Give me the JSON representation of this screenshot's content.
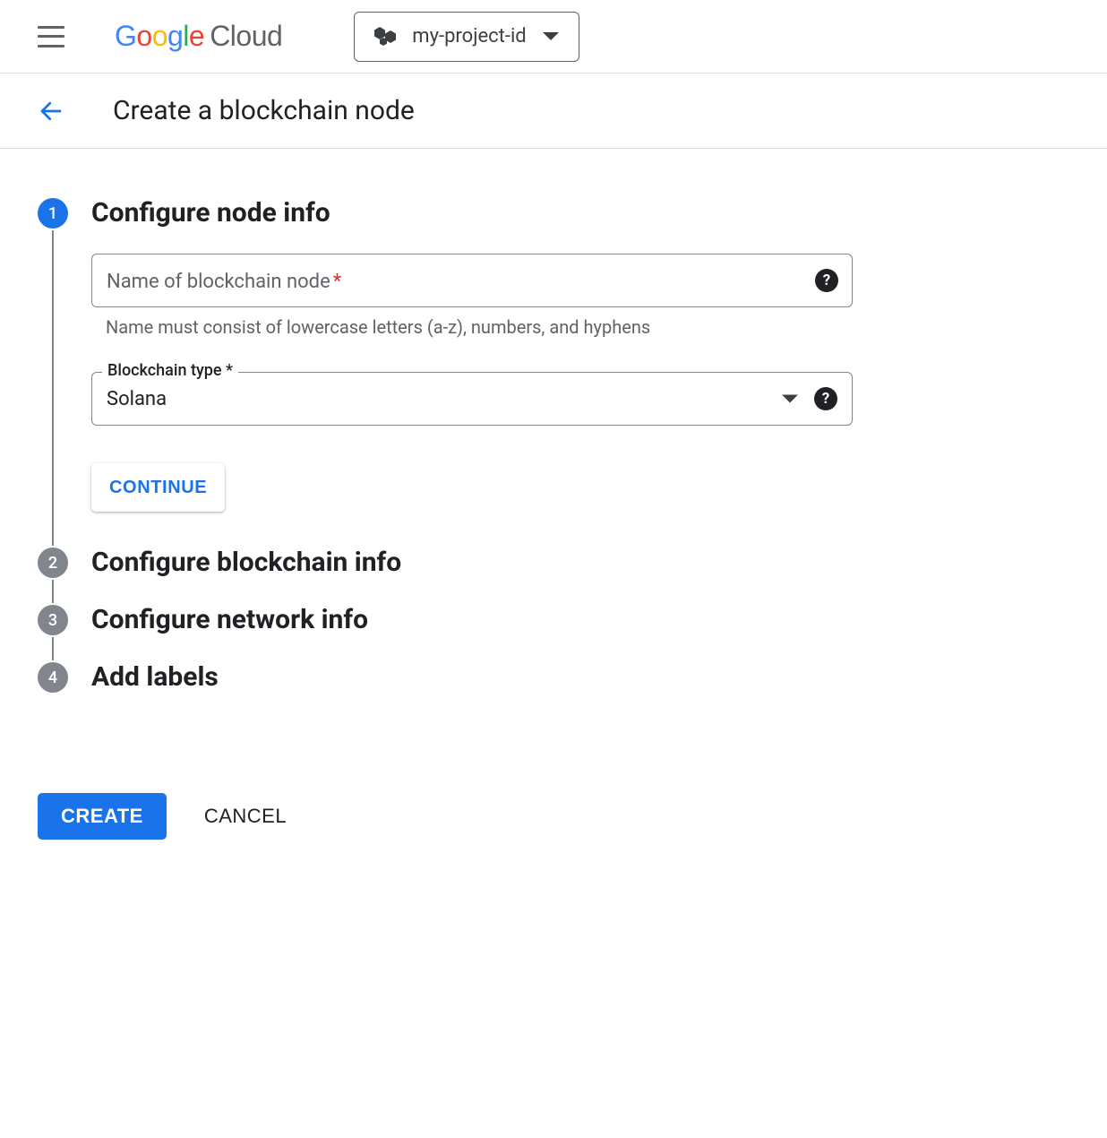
{
  "header": {
    "logo_google": "Google",
    "logo_cloud": "Cloud",
    "project_id": "my-project-id"
  },
  "page": {
    "title": "Create a blockchain node"
  },
  "steps": [
    {
      "num": "1",
      "title": "Configure node info",
      "active": true
    },
    {
      "num": "2",
      "title": "Configure blockchain info",
      "active": false
    },
    {
      "num": "3",
      "title": "Configure network info",
      "active": false
    },
    {
      "num": "4",
      "title": "Add labels",
      "active": false
    }
  ],
  "form": {
    "name": {
      "label": "Name of blockchain node",
      "required_marker": "*",
      "value": "",
      "hint": "Name must consist of lowercase letters (a-z), numbers, and hyphens"
    },
    "blockchain_type": {
      "label": "Blockchain type *",
      "value": "Solana"
    },
    "continue": "CONTINUE"
  },
  "footer": {
    "create": "CREATE",
    "cancel": "CANCEL"
  },
  "help_glyph": "?"
}
